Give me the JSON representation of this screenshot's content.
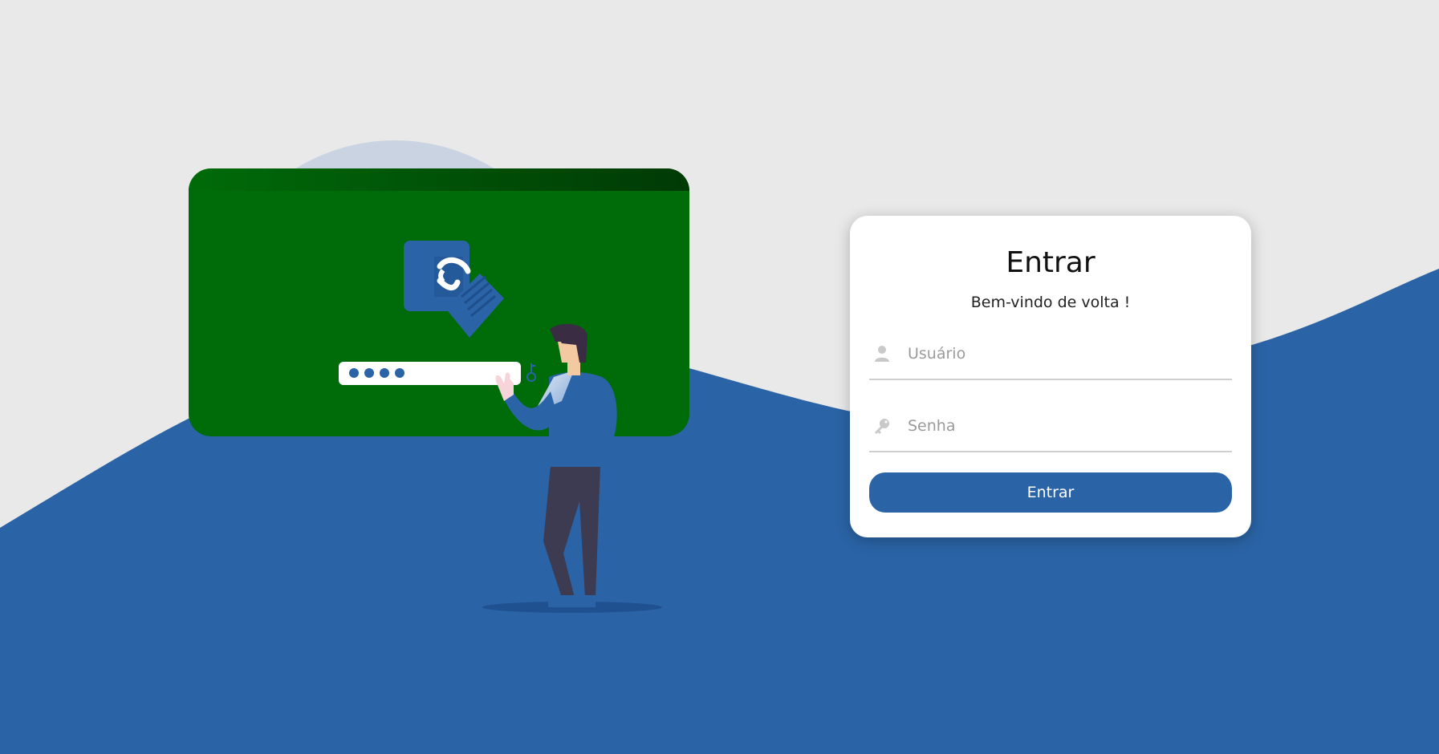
{
  "colors": {
    "background": "#e9e9e9",
    "wave": "#2b64a6",
    "screen_green": "#006b09",
    "accent_blue": "#2b64a6"
  },
  "login": {
    "title": "Entrar",
    "subtitle": "Bem-vindo de volta !",
    "username": {
      "placeholder": "Usuário",
      "value": "",
      "icon": "user-icon"
    },
    "password": {
      "placeholder": "Senha",
      "value": "",
      "icon": "key-icon"
    },
    "submit_label": "Entrar"
  },
  "illustration": {
    "description_icons": [
      "lock-document-icon",
      "password-field",
      "key-icon",
      "person-figure"
    ]
  }
}
